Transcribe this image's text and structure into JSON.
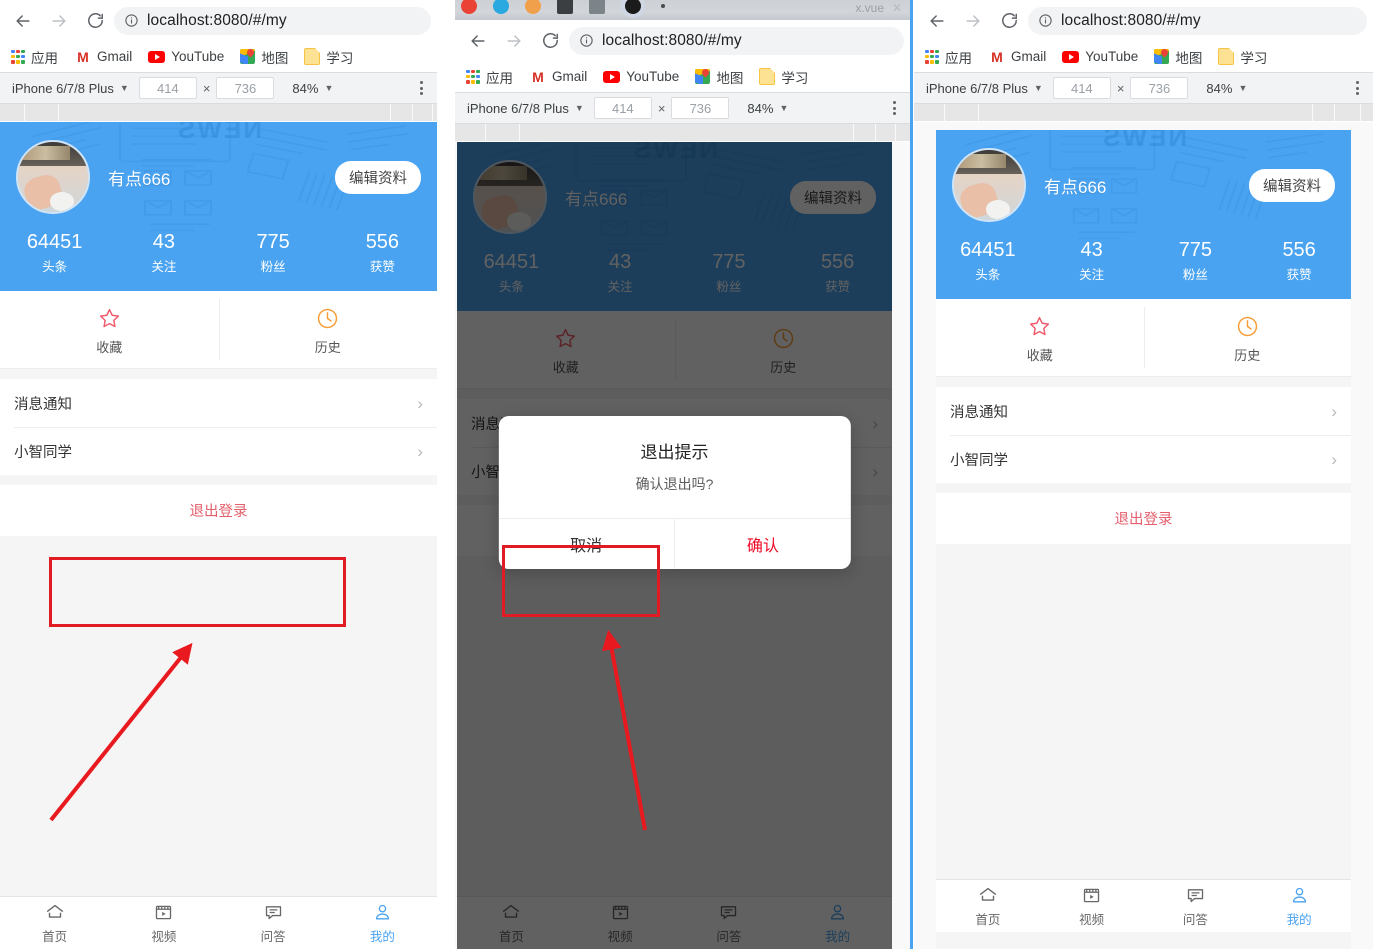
{
  "browser": {
    "tab_title": "x.vue",
    "url_host": "localhost:8080",
    "url_path": "/#/my",
    "url_full": "localhost:8080/#/my",
    "back_icon": "back-arrow-icon",
    "forward_icon": "forward-arrow-icon",
    "reload_icon": "reload-icon",
    "info_icon": "info-circle-icon",
    "bookmarks": [
      {
        "label": "应用",
        "icon": "apps-grid-icon"
      },
      {
        "label": "Gmail",
        "icon": "gmail-icon"
      },
      {
        "label": "YouTube",
        "icon": "youtube-icon"
      },
      {
        "label": "地图",
        "icon": "google-maps-icon"
      },
      {
        "label": "学习",
        "icon": "folder-icon"
      }
    ]
  },
  "devtools": {
    "device": "iPhone 6/7/8 Plus",
    "width": "414",
    "height": "736",
    "zoom": "84%",
    "x_separator": "×",
    "menu_icon": "kebab-menu-icon"
  },
  "profile": {
    "username": "有点666",
    "edit_button": "编辑资料",
    "avatar_icon": "user-avatar",
    "stats": [
      {
        "num": "64451",
        "label": "头条"
      },
      {
        "num": "43",
        "label": "关注"
      },
      {
        "num": "775",
        "label": "粉丝"
      },
      {
        "num": "556",
        "label": "获赞"
      }
    ],
    "background_watermark": "NEWS"
  },
  "grid": [
    {
      "label": "收藏",
      "icon": "star-icon",
      "color": "#ef5b6b"
    },
    {
      "label": "历史",
      "icon": "clock-icon",
      "color": "#f79c34"
    }
  ],
  "cells": [
    {
      "label": "消息通知",
      "arrow": "chevron-right-icon"
    },
    {
      "label": "小智同学",
      "arrow": "chevron-right-icon"
    }
  ],
  "logout_label": "退出登录",
  "tabbar": [
    {
      "label": "首页",
      "icon": "home-icon",
      "active": false
    },
    {
      "label": "视频",
      "icon": "video-icon",
      "active": false
    },
    {
      "label": "问答",
      "icon": "chat-icon",
      "active": false
    },
    {
      "label": "我的",
      "icon": "person-icon",
      "active": true
    }
  ],
  "dialog": {
    "title": "退出提示",
    "message": "确认退出吗?",
    "cancel": "取消",
    "confirm": "确认"
  },
  "colors": {
    "brand_blue": "#4aa3f0",
    "danger_red": "#ee0a24",
    "logout_red": "#e4606d",
    "annotation_red": "#e01b24",
    "star_red": "#ef5b6b",
    "clock_orange": "#f79c34"
  }
}
